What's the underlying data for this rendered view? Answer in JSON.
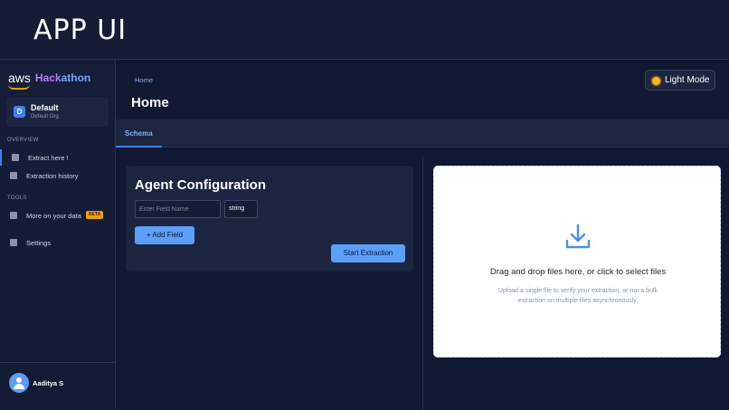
{
  "banner": {
    "title": "APP UI"
  },
  "sidebar": {
    "brand": {
      "aws": "aws",
      "hackathon_a": "Hack",
      "hackathon_b": "athon"
    },
    "org": {
      "badge": "D",
      "name": "Default",
      "sub": "Default Org"
    },
    "section_overview": "OVERVIEW",
    "section_tools": "TOOLS",
    "items": [
      {
        "label": "Extract here !",
        "active": true
      },
      {
        "label": "Extraction history"
      },
      {
        "label": "More on your data",
        "badge": "BETA"
      },
      {
        "label": "Settings"
      }
    ],
    "user": {
      "name": "Aaditya S"
    }
  },
  "header": {
    "breadcrumb": "Home",
    "title": "Home",
    "theme_toggle": {
      "label": "Light Mode",
      "icon": "sun-icon"
    }
  },
  "tabs": [
    {
      "label": "Schema",
      "active": true
    }
  ],
  "config": {
    "title": "Agent Configuration",
    "field_name_placeholder": "Enter Field Name",
    "field_name_value": "",
    "type_value": "string",
    "add_field_label": "+ Add Field",
    "start_label": "Start Extraction"
  },
  "dropzone": {
    "icon": "download-icon",
    "title": "Drag and drop files here, or click to select files",
    "subtitle": "Upload a single file to verify your extraction, or run a bulk extraction on multiple files asynchronously."
  },
  "colors": {
    "accent": "#3b82f6",
    "button": "#5aa0f8",
    "beta": "#f59e0b",
    "background": "#121a33"
  }
}
